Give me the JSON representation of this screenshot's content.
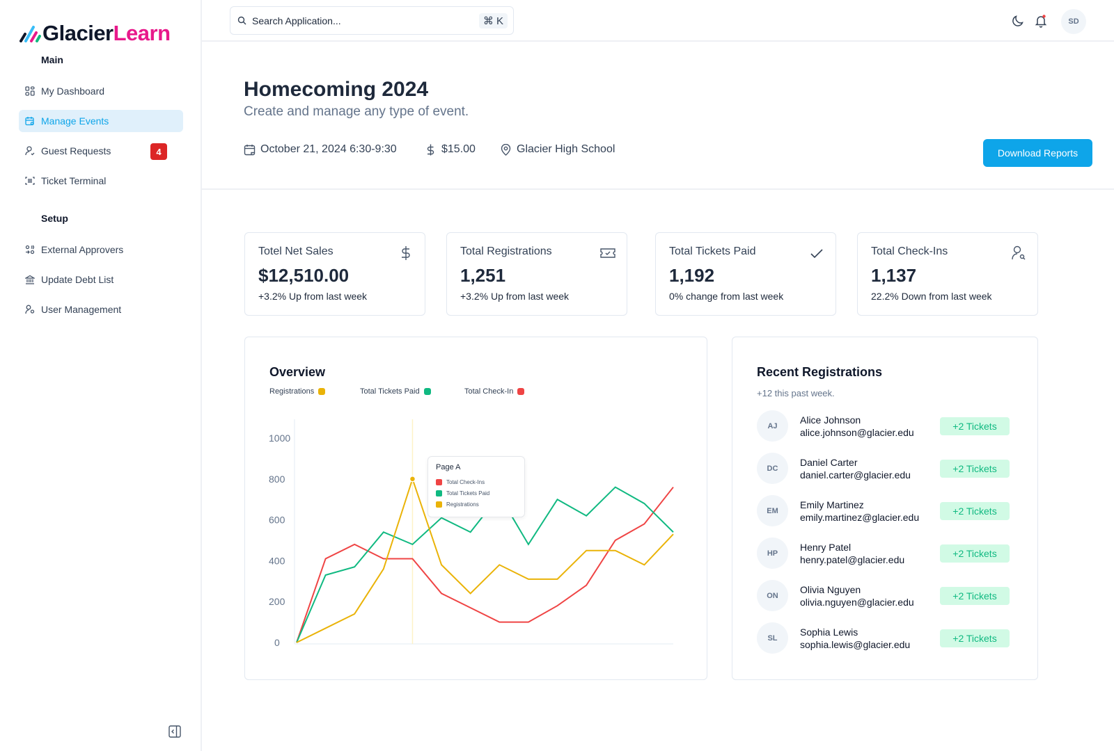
{
  "app": {
    "logo_part1": "Glacier",
    "logo_part2": "Learn",
    "brand_colors": {
      "dark": "#0f172a",
      "pink": "#e8198b",
      "accent": "#0ea5e9"
    }
  },
  "sidebar": {
    "sections": [
      {
        "label": "Main",
        "items": [
          {
            "label": "My Dashboard",
            "icon": "dashboard-grid-icon",
            "active": false
          },
          {
            "label": "Manage Events",
            "icon": "calendar-search-icon",
            "active": true
          },
          {
            "label": "Guest Requests",
            "icon": "user-check-icon",
            "active": false,
            "badge": "4"
          },
          {
            "label": "Ticket Terminal",
            "icon": "scan-barcode-icon",
            "active": false
          }
        ]
      },
      {
        "label": "Setup",
        "items": [
          {
            "label": "External Approvers",
            "icon": "users-swap-icon",
            "active": false
          },
          {
            "label": "Update Debt List",
            "icon": "bank-icon",
            "active": false
          },
          {
            "label": "User Management",
            "icon": "user-cog-icon",
            "active": false
          }
        ]
      }
    ],
    "collapse_icon": "sidebar-collapse-icon"
  },
  "topbar": {
    "search_placeholder": "Search Application...",
    "search_value": "",
    "shortcut": "⌘ K",
    "icons": [
      "moon-icon",
      "bell-icon"
    ],
    "notification_dot": true,
    "avatar_initials": "SD"
  },
  "header": {
    "title": "Homecoming 2024",
    "subtitle": "Create and manage any type of event.",
    "date": "October 21, 2024 6:30-9:30",
    "price": "$15.00",
    "location": "Glacier High School",
    "download_button": "Download Reports"
  },
  "stats": [
    {
      "label": "Totel Net Sales",
      "value": "$12,510.00",
      "change": "+3.2% Up from last week",
      "icon": "dollar-icon"
    },
    {
      "label": "Total Registrations",
      "value": "1,251",
      "change": "+3.2% Up from last week",
      "icon": "ticket-icon"
    },
    {
      "label": "Total Tickets Paid",
      "value": "1,192",
      "change": "0% change from last week",
      "icon": "check-icon"
    },
    {
      "label": "Total Check-Ins",
      "value": "1,137",
      "change": "22.2% Down from last week",
      "icon": "user-search-icon"
    }
  ],
  "overview": {
    "title": "Overview",
    "legend": [
      {
        "label": "Registrations",
        "color": "#eab308"
      },
      {
        "label": "Total Tickets Paid",
        "color": "#10b981"
      },
      {
        "label": "Total Check-In",
        "color": "#ef4444"
      }
    ],
    "tooltip": {
      "title": "Page A",
      "rows": [
        {
          "label": "Total Check-Ins",
          "color": "#ef4444"
        },
        {
          "label": "Total Tickets Paid",
          "color": "#10b981"
        },
        {
          "label": "Registrations",
          "color": "#eab308"
        }
      ],
      "active_index": 4
    }
  },
  "chart_data": {
    "type": "line",
    "title": "Overview",
    "xlabel": "",
    "ylabel": "",
    "ylim": [
      0,
      1000
    ],
    "yticks": [
      0,
      200,
      400,
      600,
      800,
      1000
    ],
    "grid": false,
    "legend_position": "top-left",
    "x": [
      0,
      1,
      2,
      3,
      4,
      5,
      6,
      7,
      8,
      9,
      10,
      11,
      12,
      13
    ],
    "series": [
      {
        "name": "Registrations",
        "color": "#eab308",
        "values": [
          0,
          70,
          140,
          360,
          800,
          380,
          240,
          380,
          310,
          310,
          450,
          450,
          380,
          530
        ]
      },
      {
        "name": "Total Tickets Paid",
        "color": "#10b981",
        "values": [
          0,
          330,
          370,
          540,
          480,
          610,
          540,
          720,
          480,
          700,
          620,
          760,
          680,
          540
        ]
      },
      {
        "name": "Total Check-In",
        "color": "#ef4444",
        "values": [
          0,
          410,
          480,
          410,
          410,
          240,
          170,
          100,
          100,
          180,
          280,
          500,
          580,
          760
        ]
      }
    ]
  },
  "recent": {
    "title": "Recent Registrations",
    "subtitle": "+12 this past week.",
    "items": [
      {
        "initials": "AJ",
        "name": "Alice Johnson",
        "email": "alice.johnson@glacier.edu",
        "badge": "+2 Tickets"
      },
      {
        "initials": "DC",
        "name": "Daniel Carter",
        "email": "daniel.carter@glacier.edu",
        "badge": "+2 Tickets"
      },
      {
        "initials": "EM",
        "name": "Emily Martinez",
        "email": "emily.martinez@glacier.edu",
        "badge": "+2 Tickets"
      },
      {
        "initials": "HP",
        "name": "Henry Patel",
        "email": "henry.patel@glacier.edu",
        "badge": "+2 Tickets"
      },
      {
        "initials": "ON",
        "name": "Olivia Nguyen",
        "email": "olivia.nguyen@glacier.edu",
        "badge": "+2 Tickets"
      },
      {
        "initials": "SL",
        "name": "Sophia Lewis",
        "email": "sophia.lewis@glacier.edu",
        "badge": "+2 Tickets"
      }
    ]
  }
}
